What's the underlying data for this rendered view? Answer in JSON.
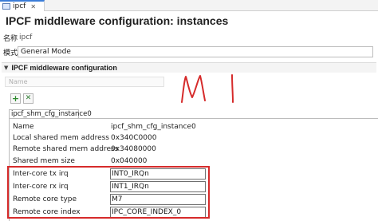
{
  "window": {
    "tab_label": "ipcf",
    "tab_close": "✕",
    "accent_color": "#3b7dd8"
  },
  "header": {
    "title": "IPCF middleware configuration: instances"
  },
  "general": {
    "name_label": "名称",
    "name_value": "ipcf",
    "mode_label": "模式",
    "mode_value": "General Mode"
  },
  "section": {
    "chevron": "▼",
    "title": "IPCF middleware configuration",
    "name_placeholder": "Name"
  },
  "toolbar": {
    "add_icon": "+",
    "remove_icon": "✕"
  },
  "instance_tab": {
    "label": "ipcf_shm_cfg_instance0"
  },
  "properties": [
    {
      "label": "Name",
      "value": "ipcf_shm_cfg_instance0"
    },
    {
      "label": "Local shared mem address",
      "value": "0x340C0000"
    },
    {
      "label": "Remote shared mem address",
      "value": "0x34080000"
    },
    {
      "label": "Shared mem size",
      "value": "0x040000"
    },
    {
      "label": "Inter-core tx irq",
      "value": "INT0_IRQn"
    },
    {
      "label": "Inter-core rx irq",
      "value": "INT1_IRQn"
    },
    {
      "label": "Remote core type",
      "value": "M7"
    },
    {
      "label": "Remote core index",
      "value": "IPC_CORE_INDEX_0"
    }
  ],
  "highlight_color": "#d62b2b"
}
